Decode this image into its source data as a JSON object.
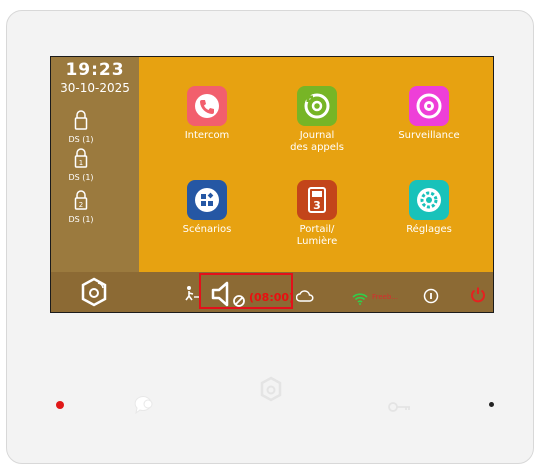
{
  "status": {
    "time": "19:23",
    "date": "30-10-2025"
  },
  "doorstations": [
    {
      "lock_number": "",
      "label": "DS (1)"
    },
    {
      "lock_number": "1",
      "label": "DS (1)"
    },
    {
      "lock_number": "2",
      "label": "DS (1)"
    }
  ],
  "tiles": [
    {
      "label": "Intercom",
      "color": "#f25f6d",
      "icon": "phone-icon"
    },
    {
      "label": "Journal\ndes appels",
      "color": "#77b526",
      "icon": "call-log-icon"
    },
    {
      "label": "Surveillance",
      "color": "#ee3fd8",
      "icon": "camera-icon"
    },
    {
      "label": "Scénarios",
      "color": "#2557a4",
      "icon": "scenarios-icon"
    },
    {
      "label": "Portail/\nLumière",
      "color": "#c3451a",
      "icon": "gate-icon"
    },
    {
      "label": "Réglages",
      "color": "#18c2ba",
      "icon": "settings-icon"
    }
  ],
  "bottom_bar": {
    "mute_timer": "(08:00)",
    "wifi_name": "Freeb...",
    "power_color": "#e62020"
  },
  "colors": {
    "sidebar": "#9b7a3e",
    "main_bg": "#e7a211",
    "bottom_bar": "#8c6a34",
    "highlight": "#e3101a"
  }
}
